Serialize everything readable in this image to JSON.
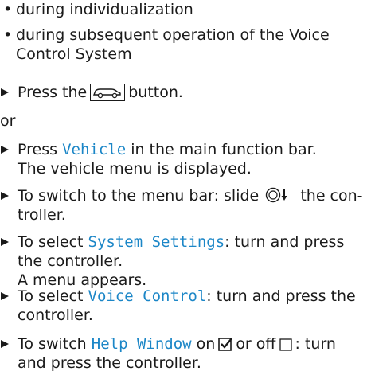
{
  "bullets": [
    "during individualization",
    "during subsequent operation of the Voice",
    "Control System"
  ],
  "steps": {
    "press_btn_pre": "Press the",
    "press_btn_post": "button.",
    "or": "or",
    "vehicle_pre": "Press",
    "vehicle_hl": "Vehicle",
    "vehicle_post": "in the main function bar.",
    "vehicle_result": "The vehicle menu is displayed.",
    "menubar_pre": "To switch to the menu bar: slide",
    "menubar_post": "the con-",
    "menubar_cont": "troller.",
    "sys_pre": "To select",
    "sys_hl": "System Settings",
    "sys_post": ": turn and press",
    "sys_cont": "the controller.",
    "sys_result": "A menu appears.",
    "voice_pre": "To select",
    "voice_hl": "Voice Control",
    "voice_post": ": turn and press the",
    "voice_cont": "controller.",
    "help_pre": "To switch",
    "help_hl": "Help Window",
    "help_mid": "on",
    "help_mid2": "or off",
    "help_post": ": turn",
    "help_cont": "and press the controller."
  },
  "icons": {
    "bullet": "•",
    "arrow": "triangle-right",
    "car_button": "car-icon",
    "controller": "controller-slide-down-icon",
    "checkbox_on": "checked-box-icon",
    "checkbox_off": "empty-box-icon"
  },
  "colors": {
    "highlight": "#1b86c7",
    "text": "#1a1a1a"
  }
}
